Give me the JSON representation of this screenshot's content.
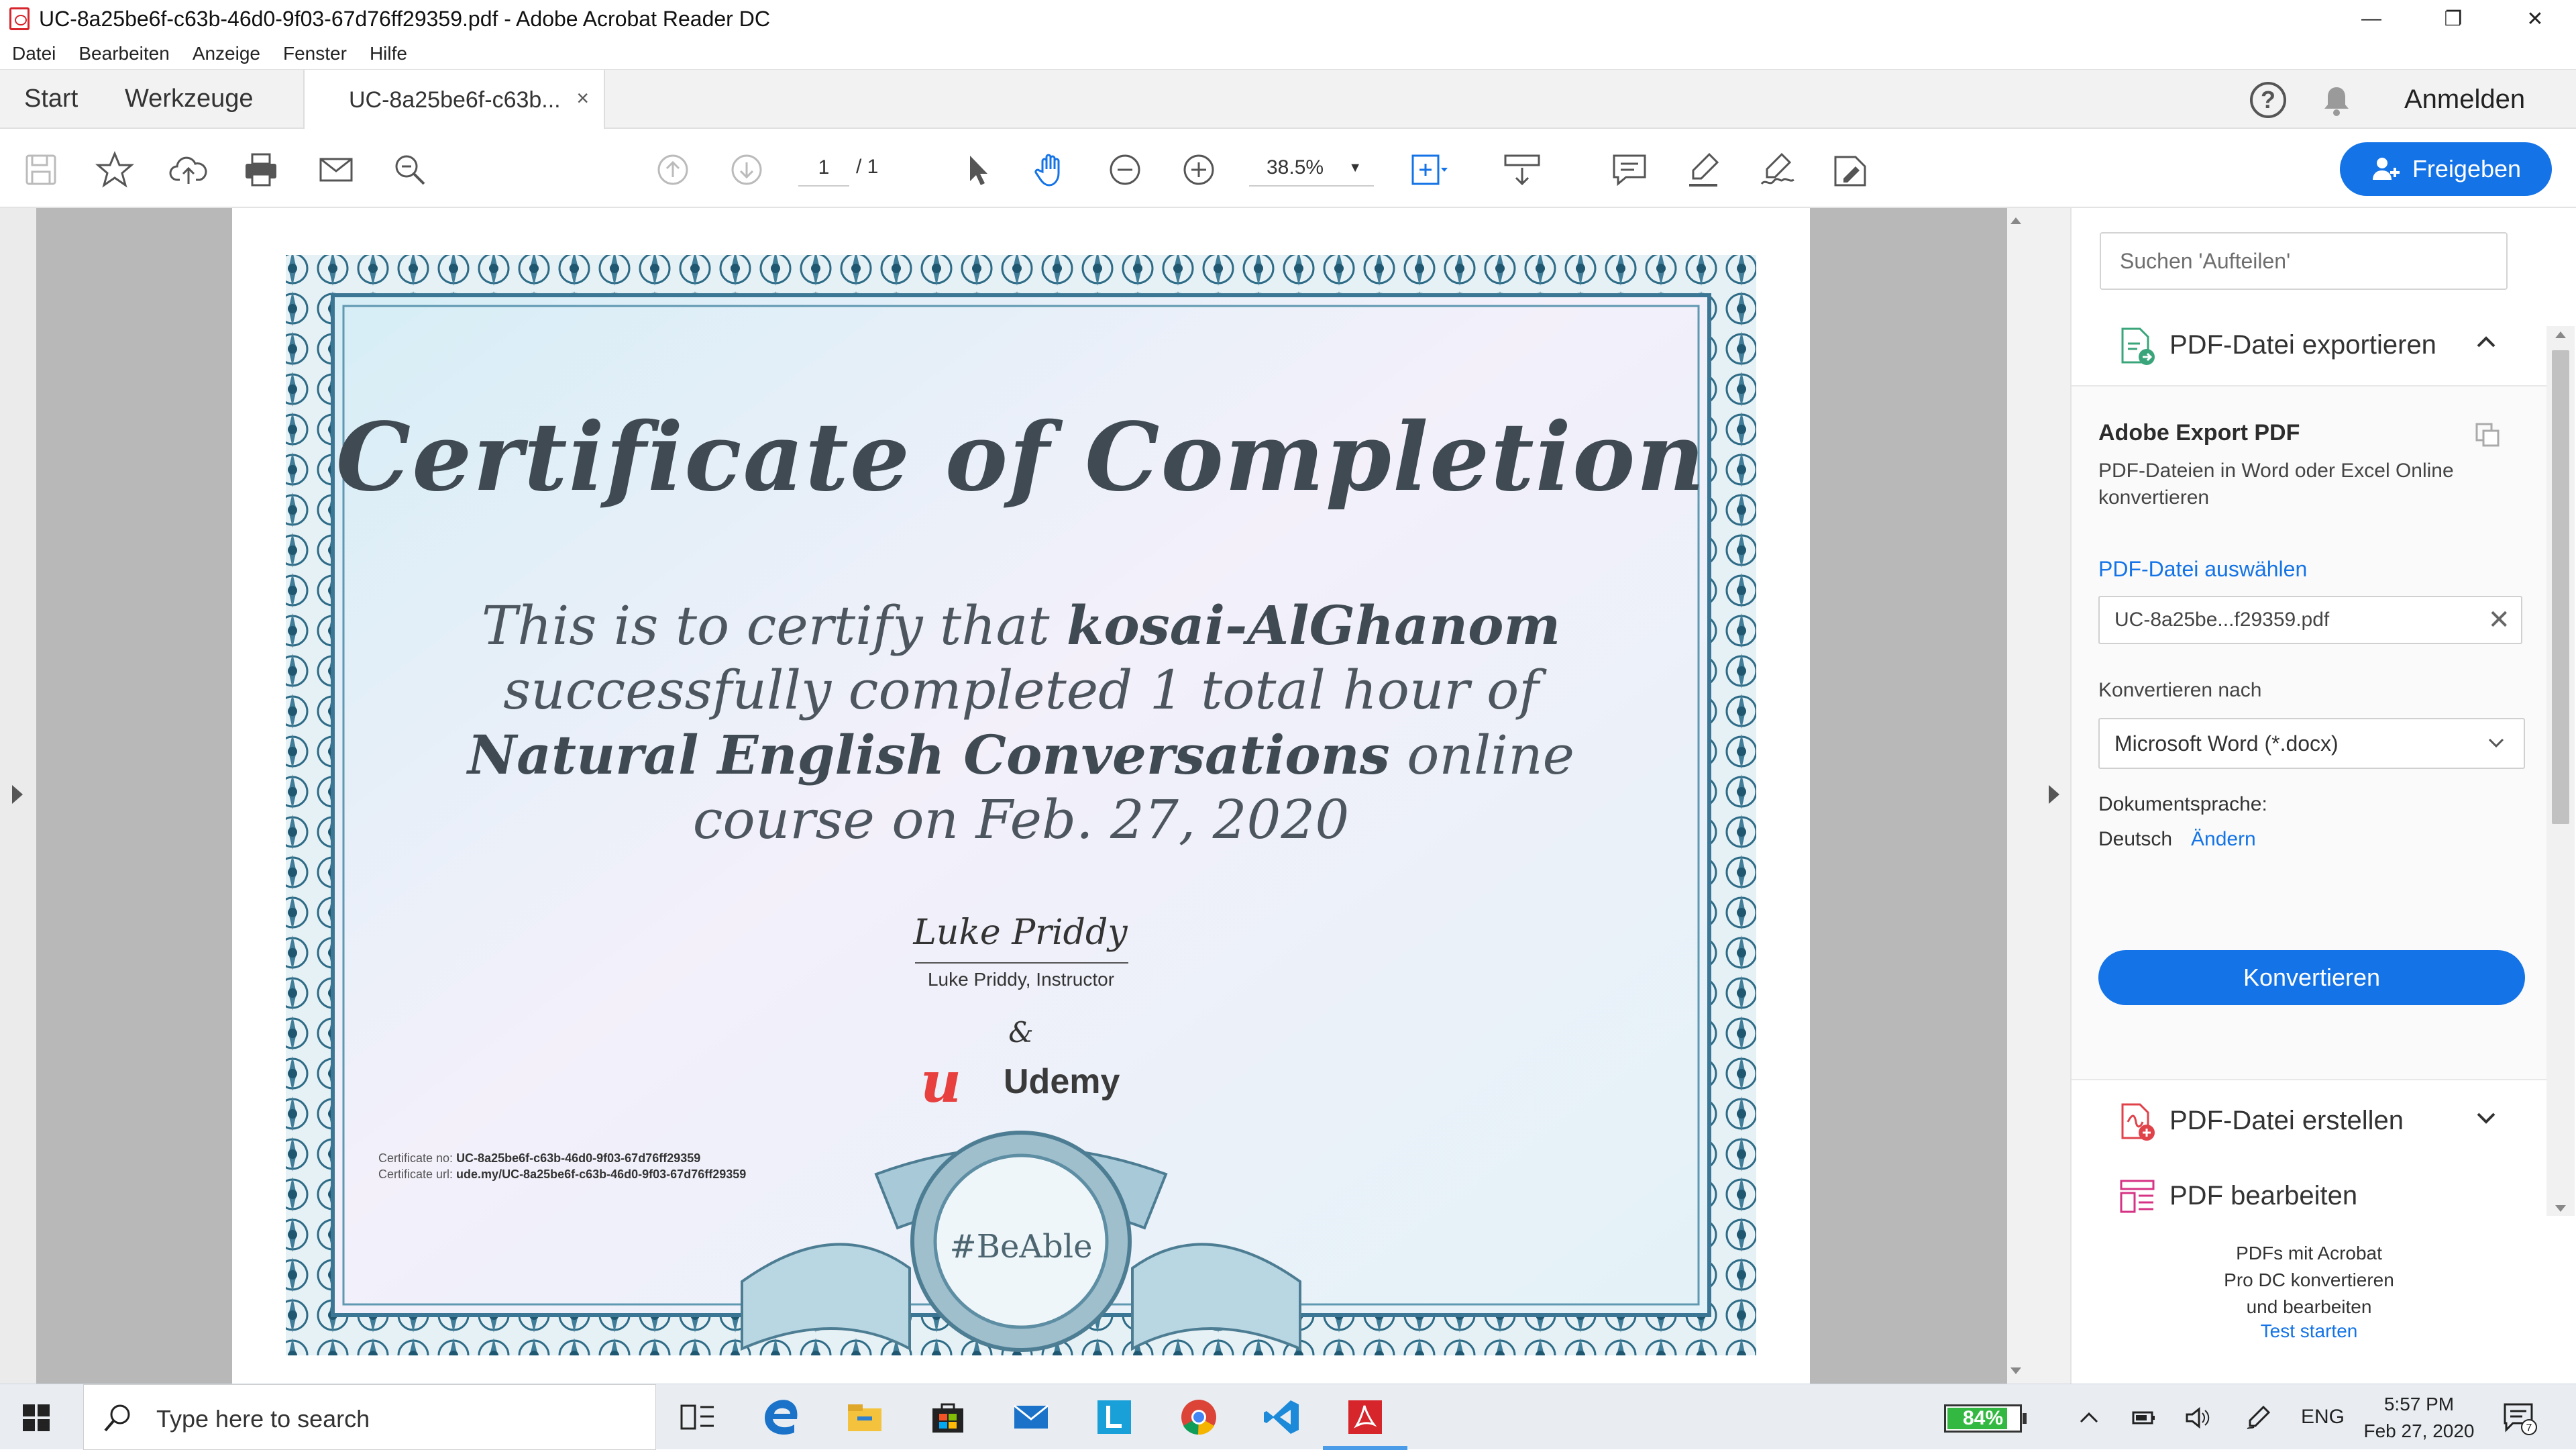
{
  "window": {
    "title": "UC-8a25be6f-c63b-46d0-9f03-67d76ff29359.pdf - Adobe Acrobat Reader DC",
    "minimize": "—",
    "maximize": "❐",
    "close": "✕"
  },
  "menu": [
    "Datei",
    "Bearbeiten",
    "Anzeige",
    "Fenster",
    "Hilfe"
  ],
  "tabs": {
    "start": "Start",
    "tools": "Werkzeuge",
    "document": "UC-8a25be6f-c63b...",
    "close": "×"
  },
  "header": {
    "signin": "Anmelden",
    "help": "?"
  },
  "toolbar": {
    "page_current": "1",
    "page_total": "/ 1",
    "zoom": "38.5%",
    "share_label": "Freigeben"
  },
  "certificate": {
    "title": "Certificate of Completion",
    "line_prefix": "This is to certify that ",
    "name": "kosai-AlGhanom",
    "line_mid": " successfully completed 1 total hour of ",
    "course": "Natural English Conversations",
    "line_suffix": " online course on Feb. 27, 2020",
    "signature": "Luke Priddy",
    "signature_caption": "Luke Priddy, Instructor",
    "ampersand": "&",
    "brand": "Udemy",
    "cert_no_label": "Certificate no: ",
    "cert_no": "UC-8a25be6f-c63b-46d0-9f03-67d76ff29359",
    "cert_url_label": "Certificate url: ",
    "cert_url": "ude.my/UC-8a25be6f-c63b-46d0-9f03-67d76ff29359",
    "badge": "#BeAble"
  },
  "panel": {
    "search_placeholder": "Suchen 'Aufteilen'",
    "export_section": "PDF-Datei exportieren",
    "export_title": "Adobe Export PDF",
    "export_desc": "PDF-Dateien in Word oder Excel Online konvertieren",
    "select_file": "PDF-Datei auswählen",
    "file_name": "UC-8a25be...f29359.pdf",
    "convert_to_label": "Konvertieren nach",
    "convert_to_value": "Microsoft Word (*.docx)",
    "doc_lang_label": "Dokumentsprache:",
    "doc_lang_value": "Deutsch",
    "doc_lang_change": "Ändern",
    "convert_button": "Konvertieren",
    "create_section": "PDF-Datei erstellen",
    "edit_section": "PDF bearbeiten",
    "promo_text": "PDFs mit Acrobat Pro DC konvertieren und bearbeiten",
    "promo_link": "Test starten"
  },
  "taskbar": {
    "search_placeholder": "Type here to search",
    "battery": "84%",
    "battery_level": 0.84,
    "language": "ENG",
    "time": "5:57 PM",
    "date": "Feb 27, 2020",
    "notif_count": "7"
  },
  "colors": {
    "accent": "#1473e6",
    "udemy_red": "#e8403e",
    "adobe_red": "#d6252b"
  }
}
